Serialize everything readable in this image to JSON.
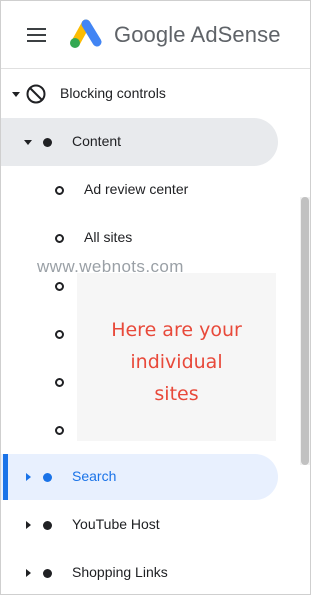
{
  "header": {
    "menu_icon": "hamburger-menu-icon",
    "logo_icon": "google-adsense-logo-icon",
    "brand": "Google AdSense",
    "logo_colors": [
      "#fbbc04",
      "#4285f4",
      "#34a853"
    ]
  },
  "nav": {
    "blocking_controls": {
      "label": "Blocking controls",
      "icon": "block-icon"
    },
    "content": {
      "label": "Content",
      "expanded": true
    },
    "ad_review_center": {
      "label": "Ad review center"
    },
    "all_sites": {
      "label": "All sites"
    },
    "search": {
      "label": "Search",
      "selected": true
    },
    "youtube_host": {
      "label": "YouTube Host"
    },
    "shopping_links": {
      "label": "Shopping Links"
    }
  },
  "watermark": "www.webnots.com",
  "overlay": {
    "lines": [
      "Here are your",
      "individual",
      "sites"
    ]
  },
  "colors": {
    "accent": "#1a73e8",
    "selected_bg": "#e8f0fe",
    "expanded_bg": "#e8eaed",
    "annotation": "#e8493a"
  }
}
